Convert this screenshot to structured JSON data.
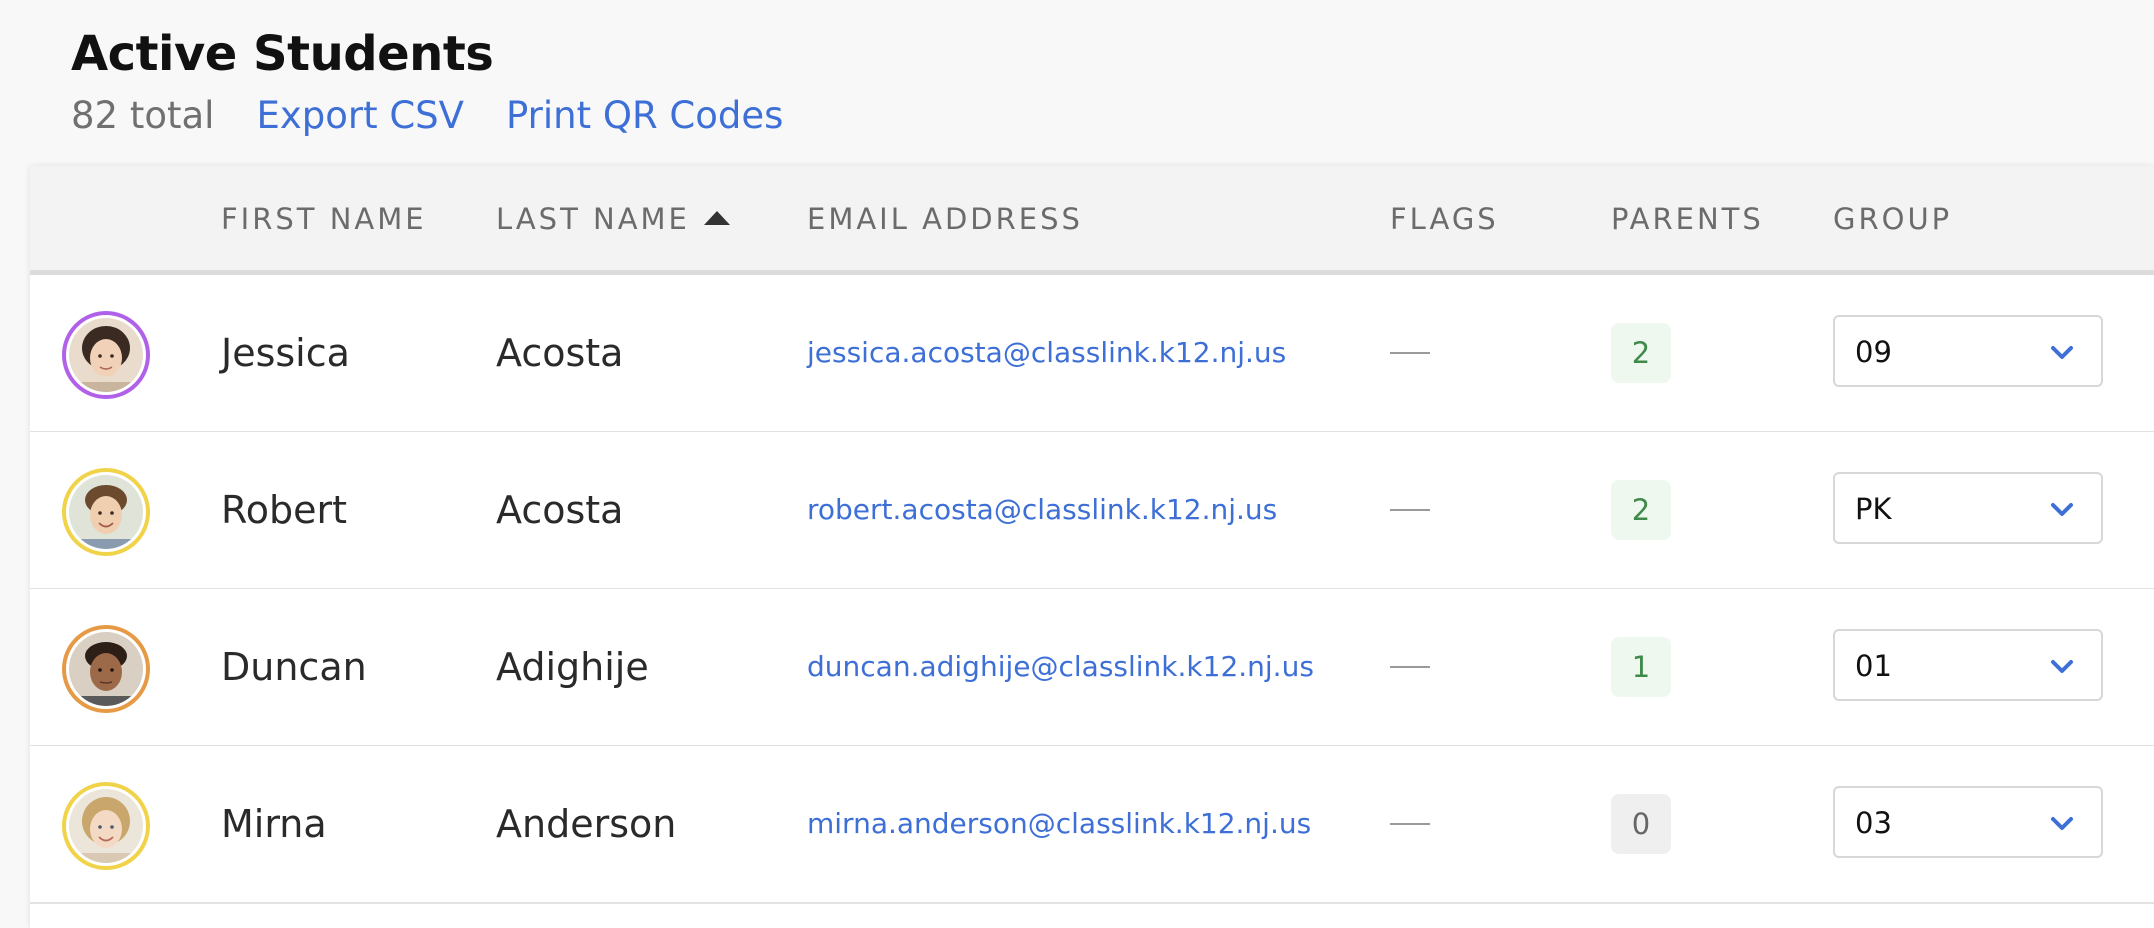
{
  "header": {
    "title": "Active Students",
    "total": "82 total",
    "export_link": "Export CSV",
    "print_link": "Print QR Codes"
  },
  "table": {
    "columns": {
      "first_name": "FIRST NAME",
      "last_name": "LAST NAME",
      "email": "EMAIL ADDRESS",
      "flags": "FLAGS",
      "parents": "PARENTS",
      "group": "GROUP"
    },
    "sort": {
      "column": "last_name",
      "direction": "ascending"
    },
    "rows": [
      {
        "first_name": "Jessica",
        "last_name": "Acosta",
        "email": "jessica.acosta@classlink.k12.nj.us",
        "flags": "—",
        "parents": "2",
        "group": "09",
        "avatar_ring_color": "#b061e8"
      },
      {
        "first_name": "Robert",
        "last_name": "Acosta",
        "email": "robert.acosta@classlink.k12.nj.us",
        "flags": "—",
        "parents": "2",
        "group": "PK",
        "avatar_ring_color": "#f1d34a"
      },
      {
        "first_name": "Duncan",
        "last_name": "Adighije",
        "email": "duncan.adighije@classlink.k12.nj.us",
        "flags": "—",
        "parents": "1",
        "group": "01",
        "avatar_ring_color": "#e69a45"
      },
      {
        "first_name": "Mirna",
        "last_name": "Anderson",
        "email": "mirna.anderson@classlink.k12.nj.us",
        "flags": "—",
        "parents": "0",
        "group": "03",
        "avatar_ring_color": "#f1d34a"
      }
    ]
  },
  "colors": {
    "link": "#3d6fd6",
    "badge_positive_bg": "#eef8ee",
    "badge_positive_text": "#3f8a4a",
    "badge_zero_bg": "#efefef"
  },
  "icons": {
    "sort": "sort-ascending-icon",
    "dropdown": "chevron-down-icon",
    "avatar": "student-avatar"
  }
}
